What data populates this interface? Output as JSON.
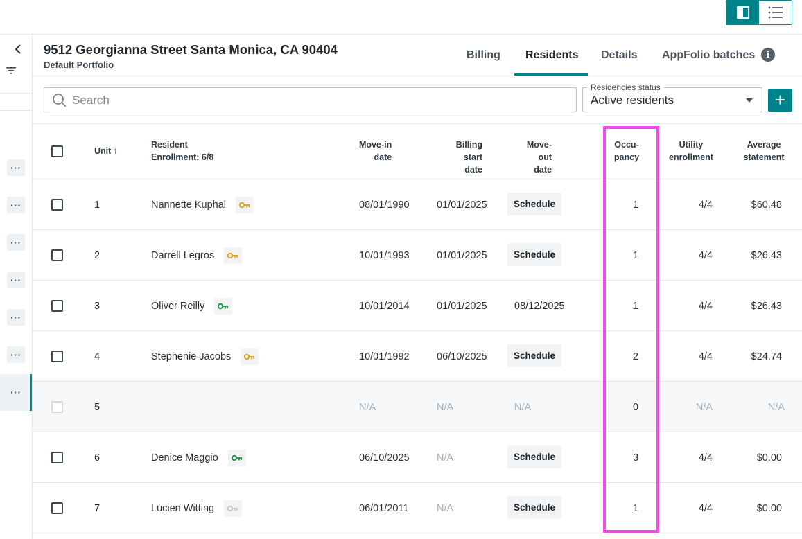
{
  "property": {
    "address": "9512 Georgianna Street Santa Monica, CA 90404",
    "portfolio": "Default Portfolio"
  },
  "tabs": [
    {
      "label": "Billing",
      "active": false
    },
    {
      "label": "Residents",
      "active": true
    },
    {
      "label": "Details",
      "active": false
    },
    {
      "label": "AppFolio batches",
      "active": false
    }
  ],
  "toolbar": {
    "search_placeholder": "Search",
    "status_label": "Residencies status",
    "status_value": "Active residents",
    "add_label": "+"
  },
  "columns": {
    "unit": "Unit",
    "resident": "Resident",
    "enrollment": "Enrollment: 6/8",
    "movein_1": "Move-in",
    "movein_2": "date",
    "billing_1": "Billing start",
    "billing_2": "date",
    "moveout_1": "Move-out",
    "moveout_2": "date",
    "occupancy_1": "Occu-",
    "occupancy_2": "pancy",
    "utility_1": "Utility",
    "utility_2": "enrollment",
    "average_1": "Average",
    "average_2": "statement"
  },
  "rows": [
    {
      "unit": "1",
      "resident": "Nannette Kuphal",
      "key": "gold",
      "movein": "08/01/1990",
      "billing": "01/01/2025",
      "moveout": "Schedule",
      "moveout_is_button": true,
      "occupancy": "1",
      "utility": "4/4",
      "average": "$60.48",
      "disabled": false
    },
    {
      "unit": "2",
      "resident": "Darrell Legros",
      "key": "gold",
      "movein": "10/01/1993",
      "billing": "01/01/2025",
      "moveout": "Schedule",
      "moveout_is_button": true,
      "occupancy": "1",
      "utility": "4/4",
      "average": "$26.43",
      "disabled": false
    },
    {
      "unit": "3",
      "resident": "Oliver Reilly",
      "key": "green",
      "movein": "10/01/2014",
      "billing": "01/01/2025",
      "moveout": "08/12/2025",
      "moveout_is_button": false,
      "occupancy": "1",
      "utility": "4/4",
      "average": "$26.43",
      "disabled": false
    },
    {
      "unit": "4",
      "resident": "Stephenie Jacobs",
      "key": "gold",
      "movein": "10/01/1992",
      "billing": "06/10/2025",
      "moveout": "Schedule",
      "moveout_is_button": true,
      "occupancy": "2",
      "utility": "4/4",
      "average": "$24.74",
      "disabled": false
    },
    {
      "unit": "5",
      "resident": "",
      "key": "",
      "movein": "N/A",
      "billing": "N/A",
      "moveout": "N/A",
      "moveout_is_button": false,
      "occupancy": "0",
      "utility": "N/A",
      "average": "N/A",
      "disabled": true
    },
    {
      "unit": "6",
      "resident": "Denice Maggio",
      "key": "green",
      "movein": "06/10/2025",
      "billing": "N/A",
      "moveout": "Schedule",
      "moveout_is_button": true,
      "occupancy": "3",
      "utility": "4/4",
      "average": "$0.00",
      "disabled": false
    },
    {
      "unit": "7",
      "resident": "Lucien Witting",
      "key": "grey",
      "movein": "06/01/2011",
      "billing": "N/A",
      "moveout": "Schedule",
      "moveout_is_button": true,
      "occupancy": "1",
      "utility": "4/4",
      "average": "$0.00",
      "disabled": false
    }
  ],
  "rail": {
    "dots_label": "···"
  },
  "colors": {
    "accent": "#00838a",
    "highlight": "#ef4ce9",
    "key_gold": "#e0a526",
    "key_green": "#1f9a45",
    "key_grey": "#c3cbd1"
  }
}
